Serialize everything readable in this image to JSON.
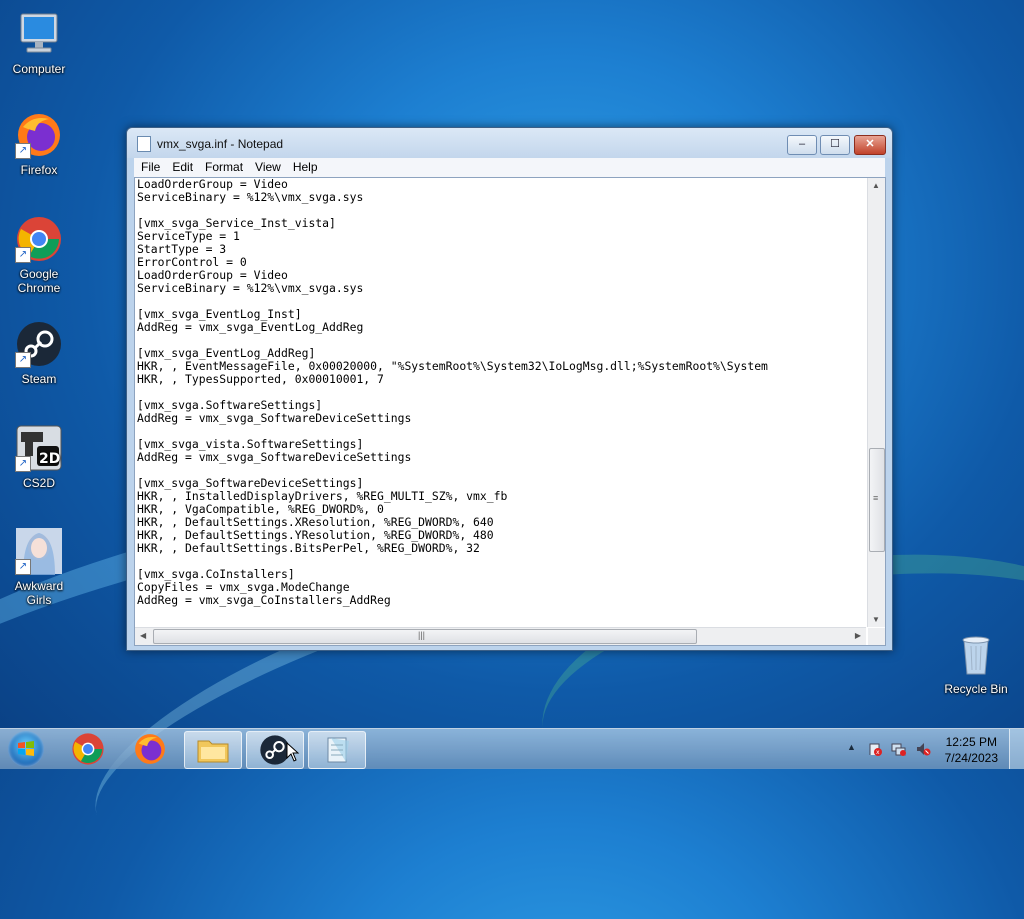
{
  "desktop": {
    "icons": [
      {
        "label": "Computer"
      },
      {
        "label": "Firefox"
      },
      {
        "label": "Google Chrome"
      },
      {
        "label": "Steam"
      },
      {
        "label": "CS2D"
      },
      {
        "label": "Awkward Girls"
      },
      {
        "label": "Recycle Bin"
      }
    ]
  },
  "window": {
    "title": "vmx_svga.inf - Notepad",
    "buttons": {
      "minimize": "‒",
      "maximize": "☐",
      "close": "✕"
    },
    "menu": [
      "File",
      "Edit",
      "Format",
      "View",
      "Help"
    ],
    "content": "LoadOrderGroup = Video\nServiceBinary = %12%\\vmx_svga.sys\n\n[vmx_svga_Service_Inst_vista]\nServiceType = 1\nStartType = 3\nErrorControl = 0\nLoadOrderGroup = Video\nServiceBinary = %12%\\vmx_svga.sys\n\n[vmx_svga_EventLog_Inst]\nAddReg = vmx_svga_EventLog_AddReg\n\n[vmx_svga_EventLog_AddReg]\nHKR, , EventMessageFile, 0x00020000, \"%SystemRoot%\\System32\\IoLogMsg.dll;%SystemRoot%\\System\nHKR, , TypesSupported, 0x00010001, 7\n\n[vmx_svga.SoftwareSettings]\nAddReg = vmx_svga_SoftwareDeviceSettings\n\n[vmx_svga_vista.SoftwareSettings]\nAddReg = vmx_svga_SoftwareDeviceSettings\n\n[vmx_svga_SoftwareDeviceSettings]\nHKR, , InstalledDisplayDrivers, %REG_MULTI_SZ%, vmx_fb\nHKR, , VgaCompatible, %REG_DWORD%, 0\nHKR, , DefaultSettings.XResolution, %REG_DWORD%, 640\nHKR, , DefaultSettings.YResolution, %REG_DWORD%, 480\nHKR, , DefaultSettings.BitsPerPel, %REG_DWORD%, 32\n\n[vmx_svga.CoInstallers]\nCopyFiles = vmx_svga.ModeChange\nAddReg = vmx_svga_CoInstallers_AddReg"
  },
  "taskbar": {
    "apps": [
      "Google Chrome",
      "Firefox",
      "File Explorer",
      "Steam",
      "Notepad"
    ],
    "clock": {
      "time": "12:25 PM",
      "date": "7/24/2023"
    }
  },
  "colors": {
    "accent": "#1d7fd1",
    "taskbar": "#8fb0cf",
    "close": "#c1422a"
  }
}
